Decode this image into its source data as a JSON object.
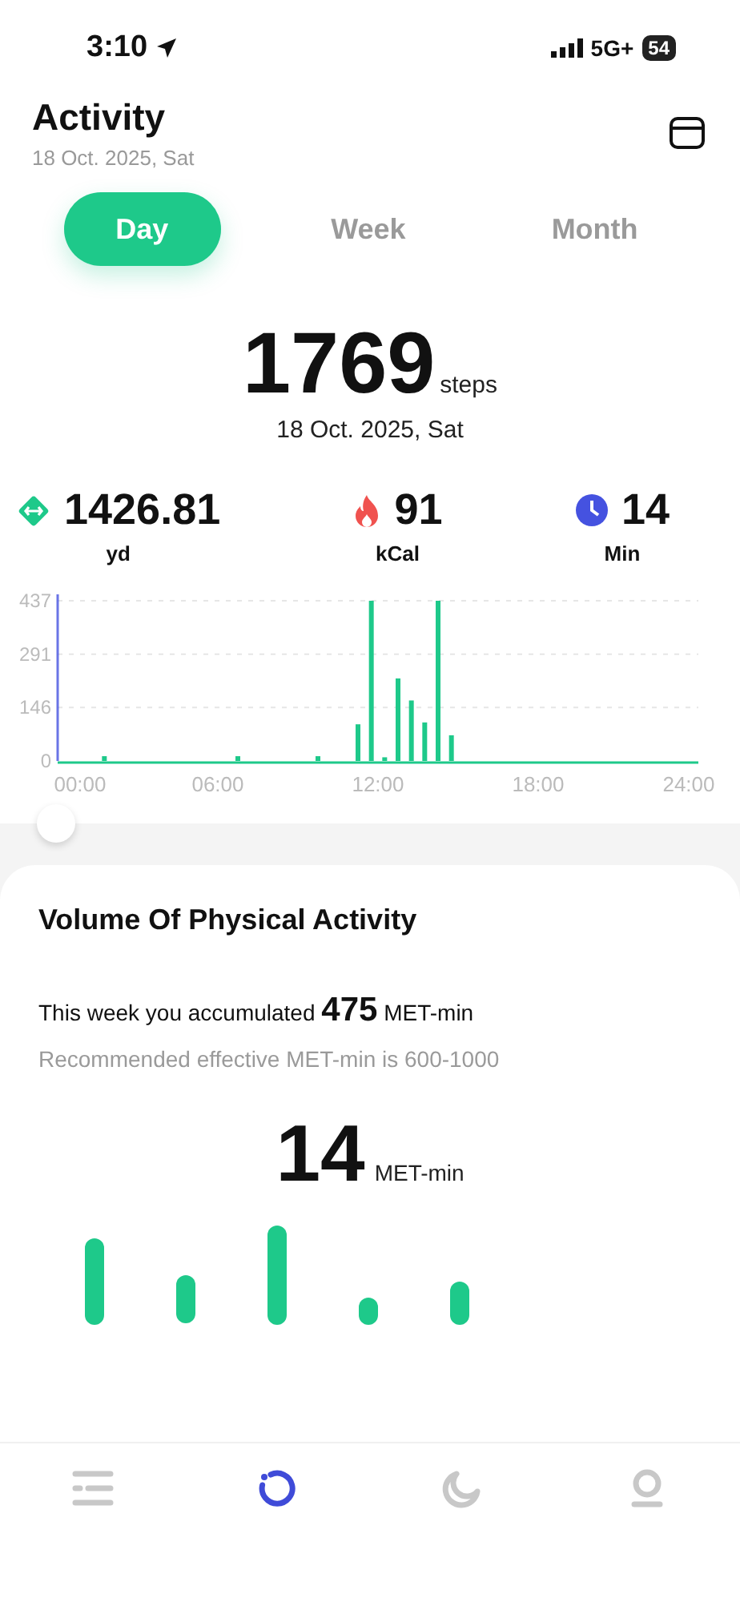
{
  "status_bar": {
    "time": "3:10",
    "network": "5G+",
    "battery": "54"
  },
  "header": {
    "title": "Activity",
    "date": "18 Oct. 2025, Sat"
  },
  "tabs": [
    {
      "label": "Day",
      "selected": true
    },
    {
      "label": "Week",
      "selected": false
    },
    {
      "label": "Month",
      "selected": false
    }
  ],
  "summary": {
    "value": "1769",
    "unit": "steps",
    "date": "18 Oct. 2025, Sat"
  },
  "stats": [
    {
      "kind": "distance",
      "value": "1426.81",
      "unit": "yd"
    },
    {
      "kind": "calories",
      "value": "91",
      "unit": "kCal"
    },
    {
      "kind": "time",
      "value": "14",
      "unit": "Min"
    }
  ],
  "steps_chart": {
    "chart_data": {
      "type": "bar",
      "x": [
        1.75,
        6.75,
        9.75,
        11.25,
        11.75,
        12.25,
        12.75,
        13.25,
        13.75,
        14.25,
        14.75
      ],
      "values": [
        13,
        13,
        13,
        100,
        437,
        10,
        225,
        165,
        105,
        437,
        70
      ],
      "xlim": [
        0,
        24
      ],
      "ylim": [
        0,
        437
      ],
      "yticks": [
        0,
        146,
        291,
        437
      ],
      "xticks": [
        {
          "value": 0,
          "label": "00:00"
        },
        {
          "value": 6,
          "label": "06:00"
        },
        {
          "value": 12,
          "label": "12:00"
        },
        {
          "value": 18,
          "label": "18:00"
        },
        {
          "value": 24,
          "label": "24:00"
        }
      ]
    }
  },
  "volume_card": {
    "title": "Volume Of Physical Activity",
    "week_prefix": "This week you accumulated",
    "week_value": "475",
    "week_unit": "MET-min",
    "recommendation": "Recommended effective MET-min is 600-1000",
    "value": "14",
    "unit": "MET-min"
  },
  "nav": [
    {
      "kind": "list",
      "selected": false
    },
    {
      "kind": "activity",
      "selected": true
    },
    {
      "kind": "sleep",
      "selected": false
    },
    {
      "kind": "profile",
      "selected": false
    }
  ]
}
